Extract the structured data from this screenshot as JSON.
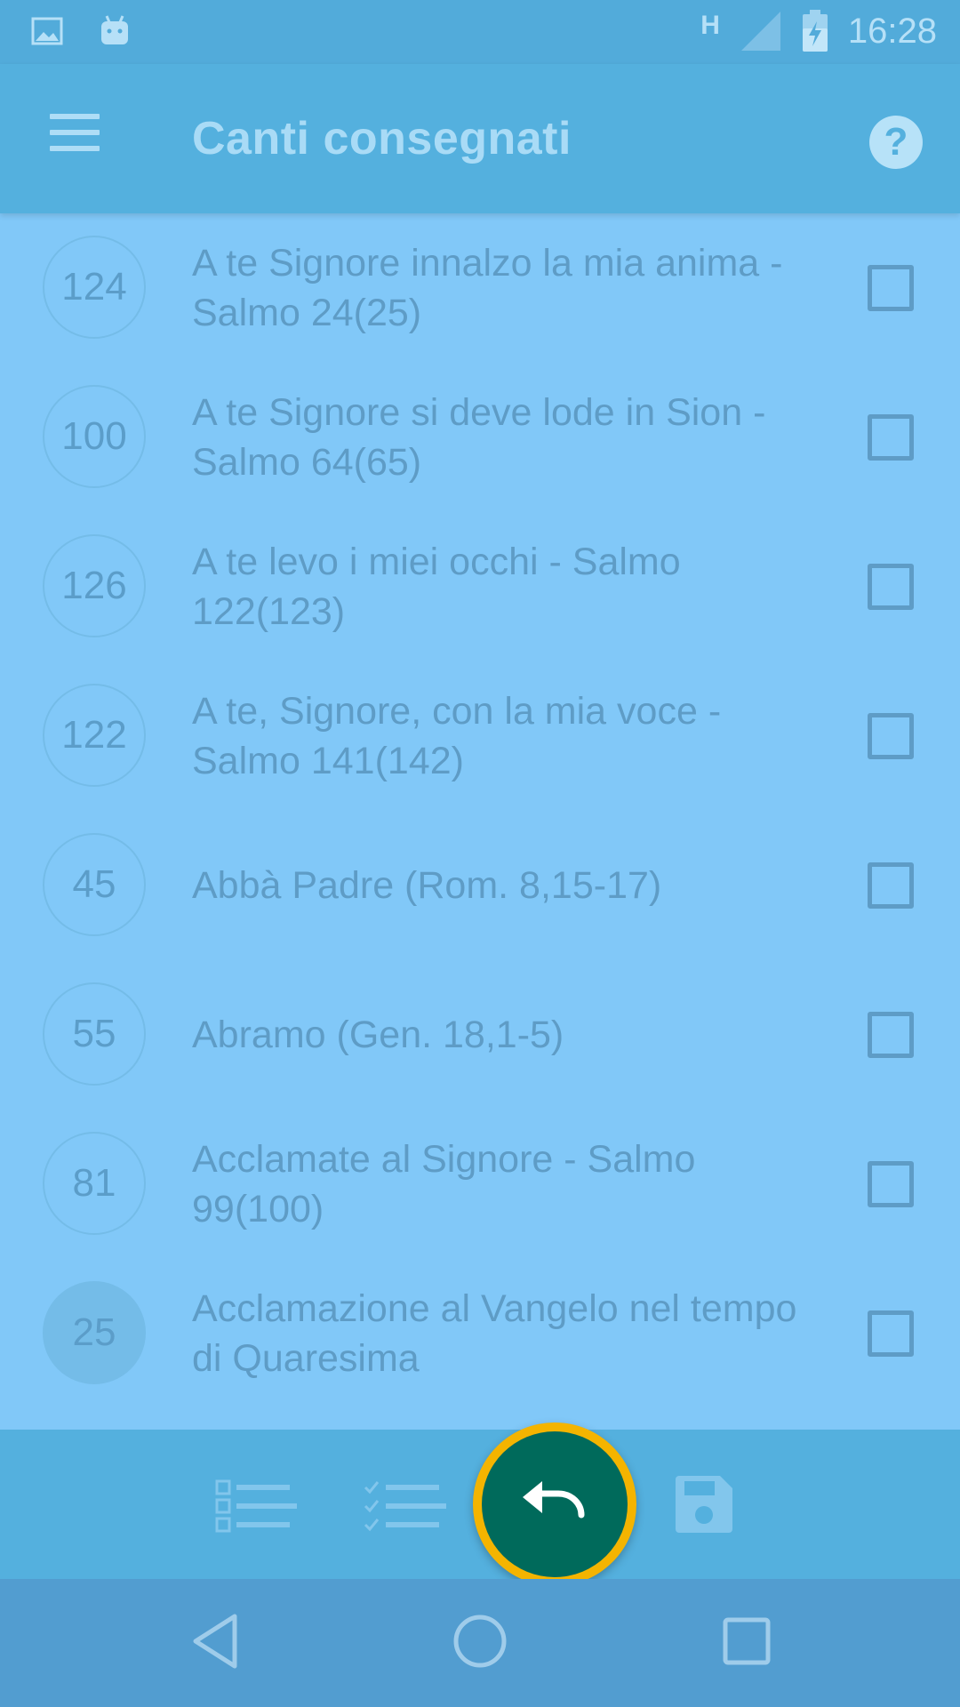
{
  "status_bar": {
    "time": "16:28",
    "network": "H",
    "icons": [
      "image-icon",
      "android-icon",
      "signal-icon",
      "battery-charging-icon"
    ]
  },
  "app_bar": {
    "title": "Canti consegnati",
    "menu_icon": "menu-icon",
    "help_icon": "help-icon",
    "help_glyph": "?"
  },
  "songs": [
    {
      "number": "124",
      "title": "A te Signore innalzo la mia anima - Salmo 24(25)",
      "checked": false
    },
    {
      "number": "100",
      "title": "A te Signore si deve lode in Sion - Salmo 64(65)",
      "checked": false
    },
    {
      "number": "126",
      "title": "A te levo i miei occhi - Salmo 122(123)",
      "checked": false
    },
    {
      "number": "122",
      "title": "A te, Signore, con la mia voce - Salmo 141(142)",
      "checked": false
    },
    {
      "number": "45",
      "title": "Abbà Padre (Rom. 8,15-17)",
      "checked": false
    },
    {
      "number": "55",
      "title": "Abramo (Gen. 18,1-5)",
      "checked": false
    },
    {
      "number": "81",
      "title": "Acclamate al Signore - Salmo 99(100)",
      "checked": false
    },
    {
      "number": "25",
      "title": "Acclamazione al Vangelo nel tempo di Quaresima",
      "checked": false
    }
  ],
  "bottom_bar": {
    "icons": [
      "select-none-icon",
      "select-all-icon",
      "undo-icon",
      "save-icon"
    ]
  },
  "colors": {
    "primary": "#54B0DE",
    "list_background": "#81C8F8",
    "fab_ring": "#F4B400",
    "fab": "#006A5B"
  },
  "nav_bar": {
    "icons": [
      "back-icon",
      "home-icon",
      "recents-icon"
    ]
  }
}
